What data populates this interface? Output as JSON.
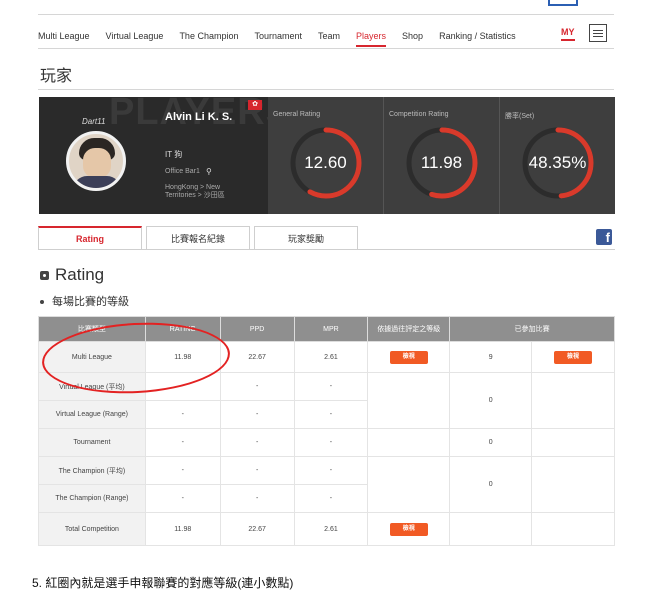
{
  "nav": {
    "items": [
      "Multi League",
      "Virtual League",
      "The Champion",
      "Tournament",
      "Team",
      "Players",
      "Shop",
      "Ranking / Statistics"
    ],
    "active": "Players",
    "my_label": "MY"
  },
  "page_title": "玩家",
  "banner": {
    "bg_text": "PLAYERS",
    "logo_text": "Dart11",
    "player_name": "Alvin Li K. S.",
    "team": "IT 狗",
    "venue": "Office Bar1",
    "region": "HongKong > New Territories > 沙田區"
  },
  "stats": [
    {
      "label": "General Rating",
      "value": "12.60",
      "fill": 0.58
    },
    {
      "label": "Competition Rating",
      "value": "11.98",
      "fill": 0.55
    },
    {
      "label": "勝率(Set)",
      "value": "48.35%",
      "fill": 0.4835
    }
  ],
  "colors": {
    "accent": "#d7262e",
    "button": "#f15a24",
    "arc": "#d93a2b"
  },
  "tabs": [
    "Rating",
    "比賽報名紀錄",
    "玩家獎勵"
  ],
  "section_title": "Rating",
  "subtitle": "每場比賽的等級",
  "table": {
    "headers": [
      "比賽類型",
      "RATING",
      "PPD",
      "MPR",
      "依據過往評定之等級",
      "已參加比賽"
    ],
    "button_label": "檢視",
    "rows": [
      {
        "type": "Multi League",
        "rating": "11.98",
        "ppd": "22.67",
        "mpr": "2.61",
        "btn1": true,
        "count": "9",
        "btn2": true
      },
      {
        "type": "Virtual League (平均)",
        "rating": "",
        "ppd": "-",
        "mpr": "-"
      },
      {
        "type": "Virtual League (Range)",
        "rating": "-",
        "ppd": "-",
        "mpr": "-",
        "count": "0"
      },
      {
        "type": "Tournament",
        "rating": "-",
        "ppd": "-",
        "mpr": "-",
        "count": "0"
      },
      {
        "type": "The Champion (平均)",
        "rating": "-",
        "ppd": "-",
        "mpr": "-"
      },
      {
        "type": "The Champion (Range)",
        "rating": "-",
        "ppd": "-",
        "mpr": "-",
        "count": "0"
      },
      {
        "type": "Total Competition",
        "rating": "11.98",
        "ppd": "22.67",
        "mpr": "2.61",
        "btn1": true
      }
    ]
  },
  "footnote": "5.  紅圈內就是選手申報聯賽的對應等級(連小數點)"
}
